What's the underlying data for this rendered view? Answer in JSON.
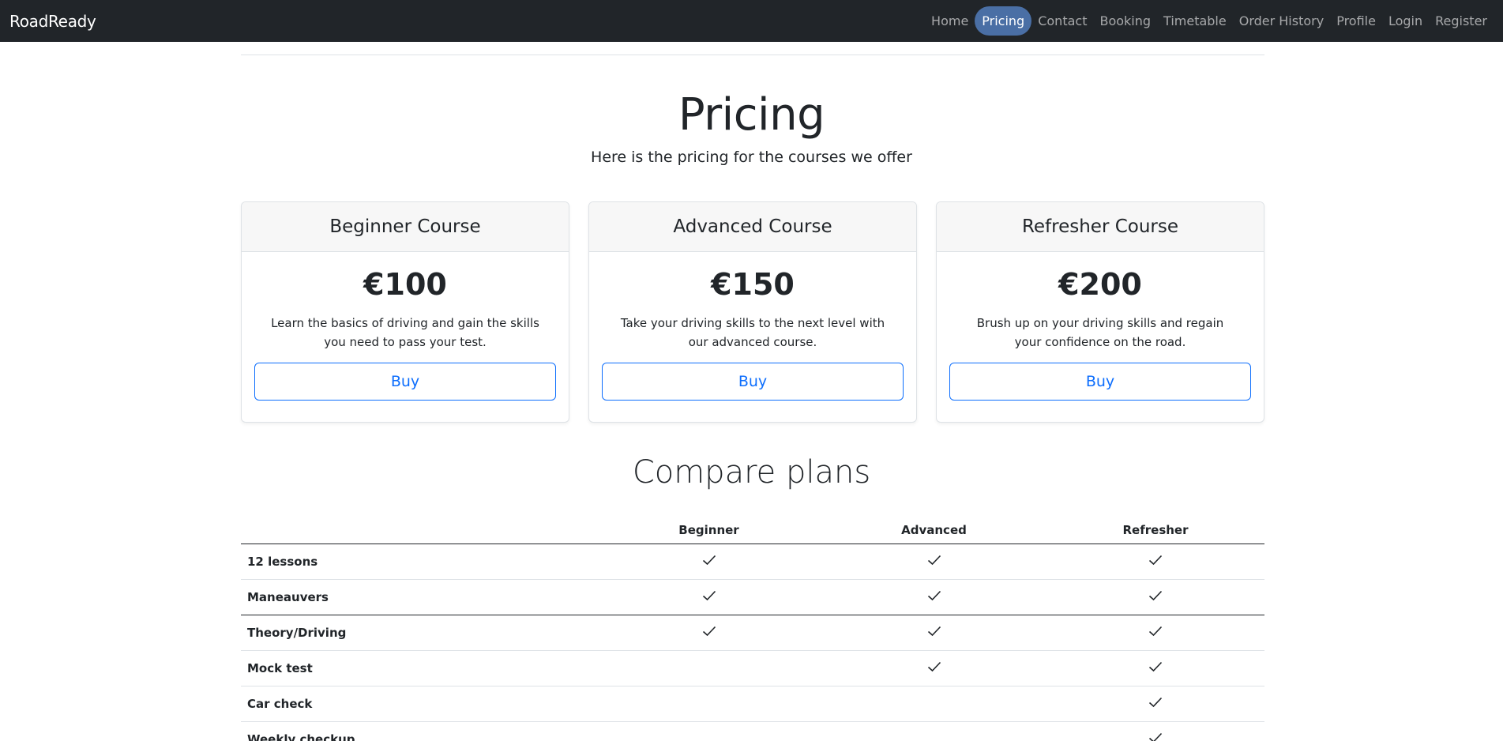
{
  "nav": {
    "brand": "RoadReady",
    "links": [
      "Home",
      "Pricing",
      "Contact",
      "Booking",
      "Timetable",
      "Order History",
      "Profile",
      "Login",
      "Register"
    ],
    "active": "Pricing"
  },
  "hero": {
    "title": "Pricing",
    "subtitle": "Here is the pricing for the courses we offer"
  },
  "cards": [
    {
      "title": "Beginner Course",
      "price": "€100",
      "description": "Learn the basics of driving and gain the skills you need to pass your test.",
      "button": "Buy"
    },
    {
      "title": "Advanced Course",
      "price": "€150",
      "description": "Take your driving skills to the next level with our advanced course.",
      "button": "Buy"
    },
    {
      "title": "Refresher Course",
      "price": "€200",
      "description": "Brush up on your driving skills and regain your confidence on the road.",
      "button": "Buy"
    }
  ],
  "compare": {
    "title": "Compare plans",
    "columns": [
      "",
      "Beginner",
      "Advanced",
      "Refresher"
    ],
    "rows": [
      {
        "feature": "12 lessons",
        "beginner": true,
        "advanced": true,
        "refresher": true
      },
      {
        "feature": "Maneauvers",
        "beginner": true,
        "advanced": true,
        "refresher": true
      },
      {
        "feature": "Theory/Driving",
        "beginner": true,
        "advanced": true,
        "refresher": true
      },
      {
        "feature": "Mock test",
        "beginner": false,
        "advanced": true,
        "refresher": true
      },
      {
        "feature": "Car check",
        "beginner": false,
        "advanced": false,
        "refresher": true
      },
      {
        "feature": "Weekly checkup",
        "beginner": false,
        "advanced": false,
        "refresher": true
      }
    ]
  },
  "colors": {
    "navbar": "#212529",
    "active_pill": "#4a6fa5",
    "primary": "#0d6efd"
  }
}
